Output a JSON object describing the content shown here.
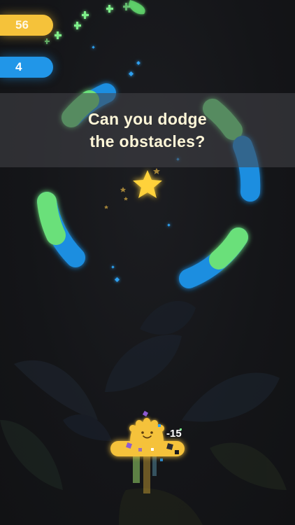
{
  "hud": {
    "score": "56",
    "level": "4"
  },
  "banner": {
    "line1": "Can you dodge",
    "line2": "the obstacles?"
  },
  "player": {
    "penalty": "-15"
  },
  "colors": {
    "green": "#6be07a",
    "blue": "#1e8ee0",
    "yellow": "#f5c23a",
    "background": "#141518"
  },
  "icons": {
    "collectible": "star-icon",
    "character": "smiling-blob-icon"
  }
}
